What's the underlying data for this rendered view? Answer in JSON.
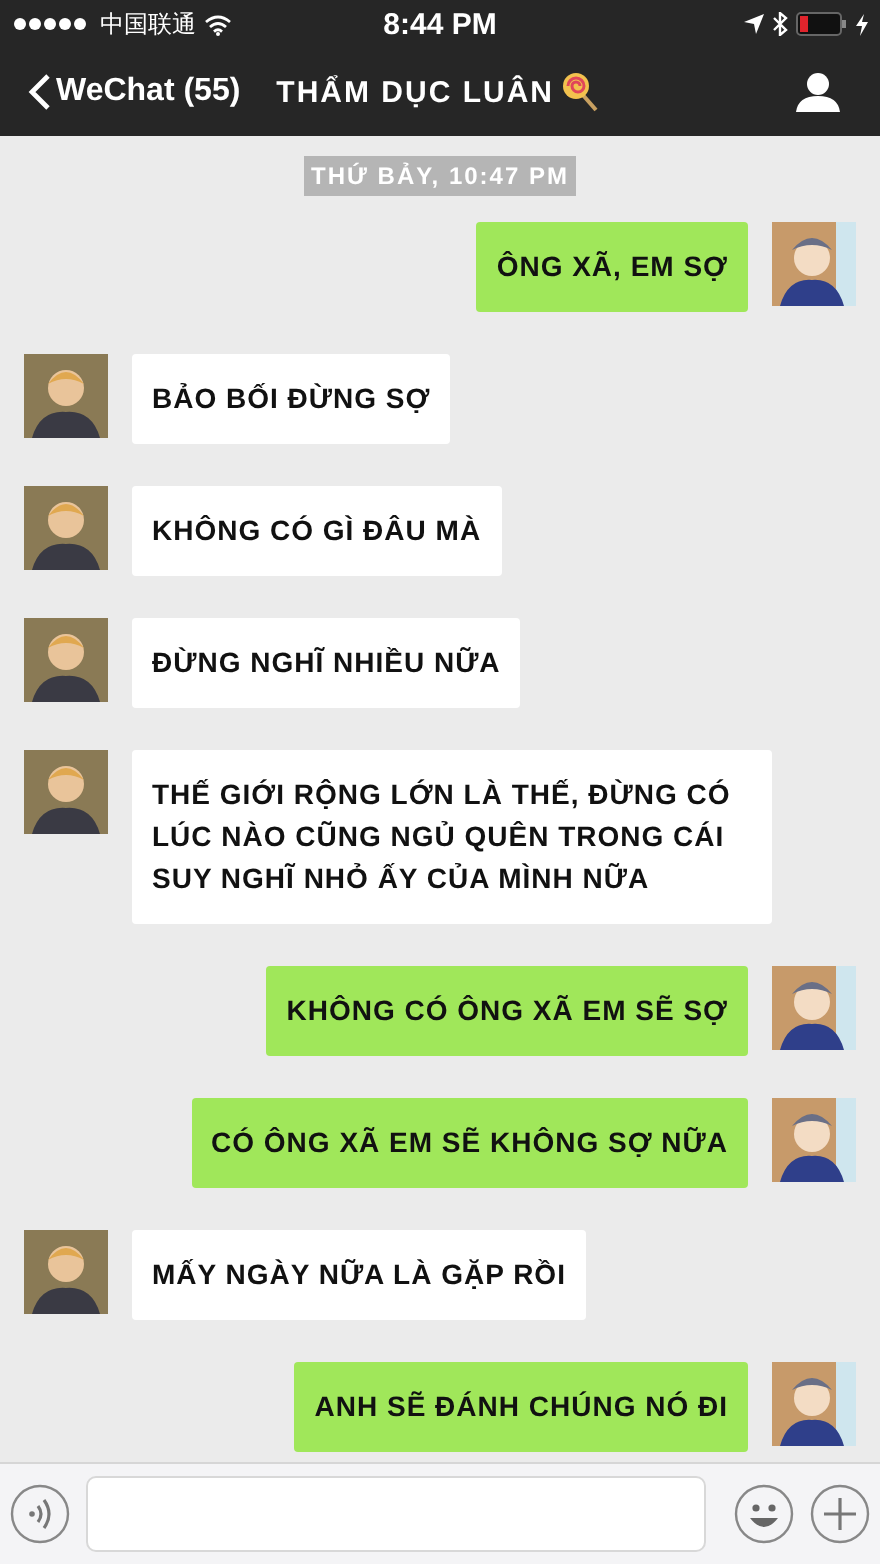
{
  "status_bar": {
    "carrier": "中国联通",
    "time": "8:44 PM"
  },
  "nav": {
    "back_label": "WeChat (55)",
    "title": "THẨM DỤC LUÂN"
  },
  "timestamp": "THỨ BẢY, 10:47 PM",
  "messages": [
    {
      "kind": "sent",
      "text": "ÔNG XÃ, EM SỢ"
    },
    {
      "kind": "received",
      "text": "BẢO BỐI ĐỪNG SỢ"
    },
    {
      "kind": "received",
      "text": "KHÔNG CÓ GÌ ĐÂU MÀ"
    },
    {
      "kind": "received",
      "text": "ĐỪNG NGHĨ NHIỀU NỮA"
    },
    {
      "kind": "received",
      "text": "THẾ GIỚI RỘNG LỚN LÀ THẾ, ĐỪNG CÓ LÚC NÀO CŨNG NGỦ QUÊN TRONG CÁI SUY NGHĨ NHỎ ẤY CỦA MÌNH NỮA"
    },
    {
      "kind": "sent",
      "text": "KHÔNG CÓ ÔNG XÃ EM SẼ SỢ"
    },
    {
      "kind": "sent",
      "text": "CÓ ÔNG XÃ EM SẼ KHÔNG SỢ NỮA"
    },
    {
      "kind": "received",
      "text": "MẤY NGÀY NỮA LÀ GẶP RỒI"
    },
    {
      "kind": "sent",
      "text": "ANH SẼ ĐÁNH CHÚNG NÓ ĐI"
    }
  ]
}
